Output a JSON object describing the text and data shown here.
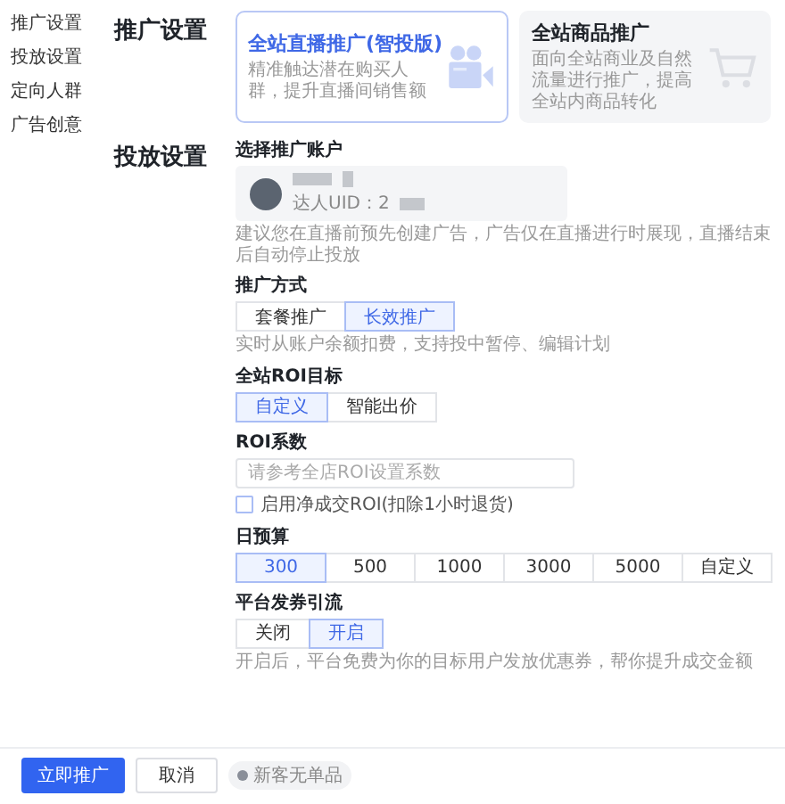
{
  "sidebar": {
    "items": [
      {
        "label": "推广设置"
      },
      {
        "label": "投放设置"
      },
      {
        "label": "定向人群"
      },
      {
        "label": "广告创意"
      }
    ]
  },
  "promo": {
    "title": "推广设置",
    "cards": [
      {
        "title": "全站直播推广(智投版)",
        "desc": "精准触达潜在购买人群，提升直播间销售额",
        "kind": "camera",
        "selected": true
      },
      {
        "title": "全站商品推广",
        "desc": "面向全站商业及自然流量进行推广，提高全站内商品转化",
        "kind": "cart",
        "selected": false
      }
    ]
  },
  "delivery": {
    "title": "投放设置",
    "account": {
      "label": "选择推广账户",
      "uid": "达人UID：2",
      "hint": "建议您在直播前预先创建广告，广告仅在直播进行时展现，直播结束后自动停止投放"
    },
    "mode": {
      "label": "推广方式",
      "options": [
        {
          "label": "套餐推广",
          "selected": false
        },
        {
          "label": "长效推广",
          "selected": true
        }
      ],
      "hint": "实时从账户余额扣费，支持投中暂停、编辑计划"
    },
    "roi_target": {
      "label": "全站ROI目标",
      "options": [
        {
          "label": "自定义",
          "selected": true
        },
        {
          "label": "智能出价",
          "selected": false
        }
      ]
    },
    "roi": {
      "label": "ROI系数",
      "placeholder": "请参考全店ROI设置系数",
      "checkbox": {
        "label": "启用净成交ROI(扣除1小时退货)",
        "checked": false
      }
    },
    "budget": {
      "label": "日预算",
      "options": [
        {
          "label": "300",
          "selected": true
        },
        {
          "label": "500",
          "selected": false
        },
        {
          "label": "1000",
          "selected": false
        },
        {
          "label": "3000",
          "selected": false
        },
        {
          "label": "5000",
          "selected": false
        },
        {
          "label": "自定义",
          "selected": false
        }
      ]
    },
    "coupon": {
      "label": "平台发券引流",
      "options": [
        {
          "label": "关闭",
          "selected": false
        },
        {
          "label": "开启",
          "selected": true
        }
      ],
      "hint": "开启后，平台免费为你的目标用户发放优惠券，帮你提升成交金额"
    }
  },
  "footer": {
    "primary": "立即推广",
    "cancel": "取消",
    "badge": "新客无单品"
  }
}
